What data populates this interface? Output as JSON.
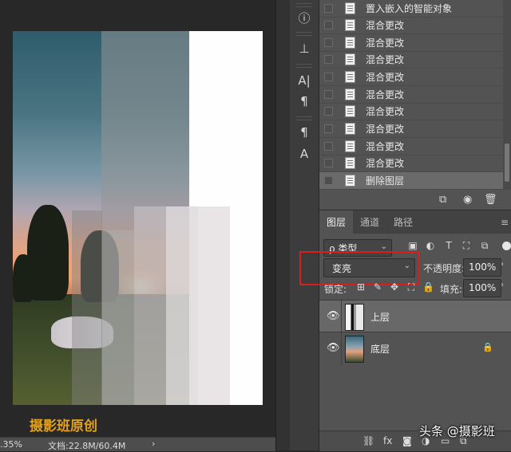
{
  "canvas": {
    "watermark": "摄影班原创",
    "status": {
      "zoom": ".35%",
      "doc_info": "文档:22.8M/60.4M",
      "arrow": "›"
    }
  },
  "tool_strip": {
    "icons": [
      "info-icon",
      "stamp-icon",
      "character-icon",
      "paragraph-icon",
      "paragraph-style-icon",
      "character-style-icon"
    ],
    "glyphs": {
      "info": "ⓘ",
      "stamp": "⊥",
      "character": "A|",
      "paragraph": "¶",
      "paragraph_style": "¶",
      "character_style": "A"
    }
  },
  "history": {
    "items": [
      "置入嵌入的智能对象",
      "混合更改",
      "混合更改",
      "混合更改",
      "混合更改",
      "混合更改",
      "混合更改",
      "混合更改",
      "混合更改",
      "混合更改",
      "删除图层"
    ],
    "footer_icons": [
      "new-document-from-state-icon",
      "camera-icon",
      "trash-icon"
    ],
    "footer_glyphs": {
      "new_doc": "⧉",
      "camera": "◉",
      "trash": "🗑"
    }
  },
  "layers_panel": {
    "tabs": [
      "图层",
      "通道",
      "路径"
    ],
    "active_tab": "图层",
    "menu_glyph": "≡",
    "filter": {
      "value": "ρ 类型",
      "chevron": "⌄"
    },
    "filter_icon_glyphs": [
      "▣",
      "◐",
      "T",
      "⛶",
      "⧉"
    ],
    "blend_mode": {
      "value": "变亮",
      "chevron": "⌄"
    },
    "opacity": {
      "label": "不透明度:",
      "value": "100%",
      "arrow": "›"
    },
    "lock": {
      "label": "锁定:",
      "icon_glyphs": [
        "⊞",
        "✎",
        "✥",
        "⛶",
        "🔒"
      ]
    },
    "fill": {
      "label": "填充:",
      "value": "100%",
      "arrow": "›"
    },
    "layers": [
      {
        "name": "上层",
        "visible_glyph": "👁",
        "locked": false
      },
      {
        "name": "底层",
        "visible_glyph": "👁",
        "locked": true,
        "lock_glyph": "🔒"
      }
    ],
    "footer_glyphs": {
      "link": "⛓",
      "fx": "fx",
      "mask": "◙",
      "adjust": "◑",
      "group": "▭",
      "new": "⧉"
    }
  },
  "overlay_watermark": "头条 @摄影班",
  "colors": {
    "highlight": "#d81e1e",
    "watermark": "#e0a020",
    "panel": "#535353",
    "canvas_bg": "#282828"
  }
}
